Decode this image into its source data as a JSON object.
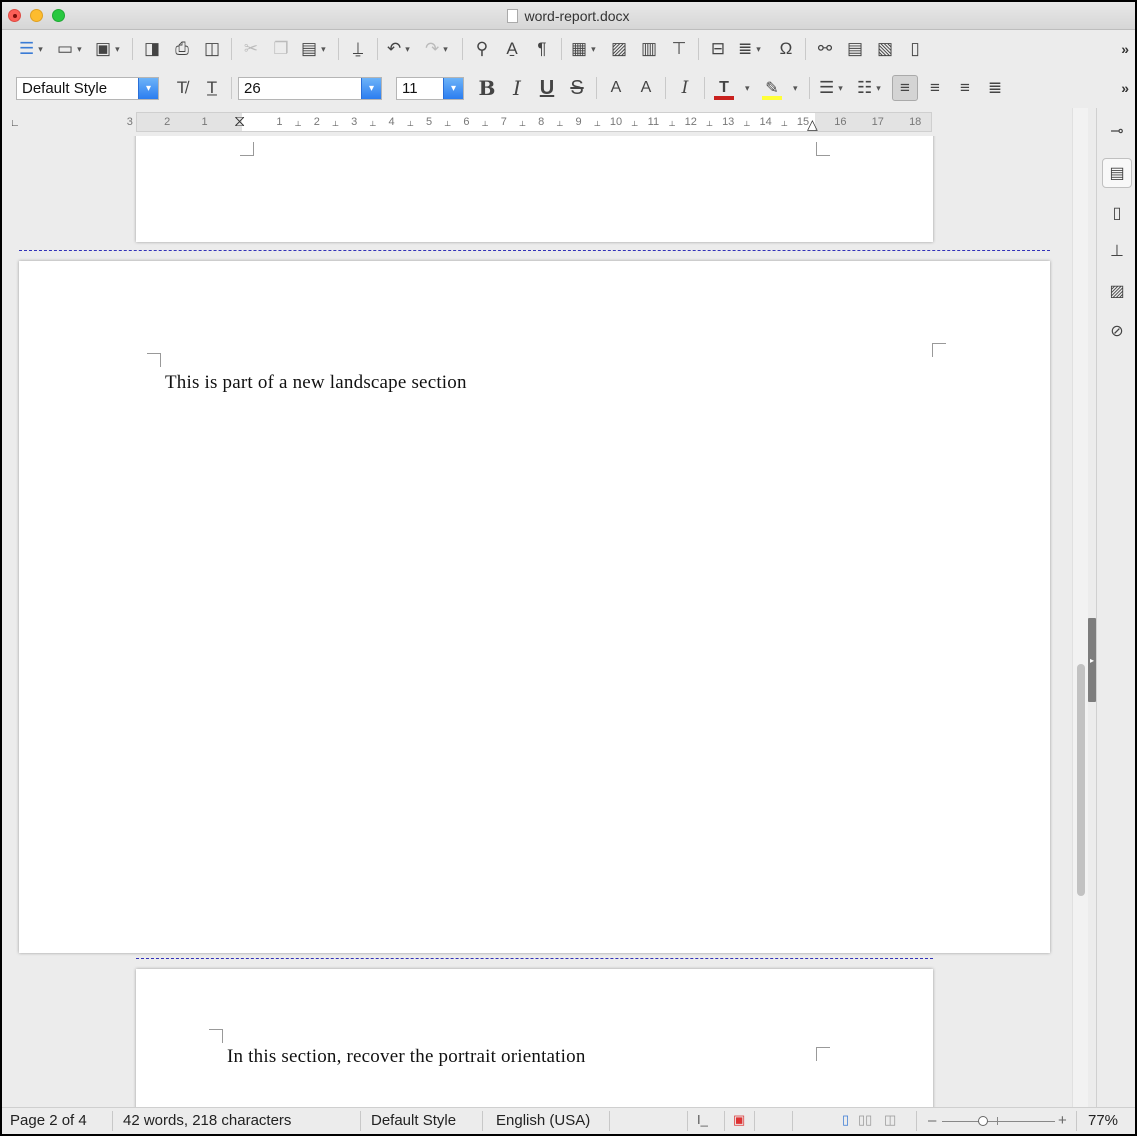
{
  "window": {
    "title": "word-report.docx"
  },
  "toolbar_standard": {
    "icons": [
      "toggle-sidebar-icon",
      "open-folder-icon",
      "save-icon",
      "export-pdf-icon",
      "print-icon",
      "print-preview-icon",
      "cut-icon",
      "copy-icon",
      "paste-icon",
      "clone-formatting-icon",
      "undo-icon",
      "redo-icon",
      "find-replace-icon",
      "spelling-icon",
      "formatting-marks-icon",
      "insert-table-icon",
      "insert-image-icon",
      "insert-chart-icon",
      "insert-textbox-icon",
      "insert-page-break-icon",
      "insert-field-icon",
      "special-character-icon",
      "insert-hyperlink-icon",
      "insert-footnote-icon",
      "insert-endnote-icon",
      "insert-bookmark-icon"
    ]
  },
  "toolbar_formatting": {
    "paragraph_style": "Default Style",
    "font_name": "26",
    "font_size": "11",
    "bold_label": "B",
    "italic_label": "I",
    "underline_label": "U",
    "strike_label": "S",
    "superscript_label": "A",
    "subscript_label": "A",
    "clear_format_label": "I",
    "font_color": "#c9211e",
    "highlight_color": "#ffff38"
  },
  "ruler": {
    "ticks": [
      "3",
      "2",
      "1",
      "1",
      "2",
      "3",
      "4",
      "5",
      "6",
      "7",
      "8",
      "9",
      "10",
      "11",
      "12",
      "13",
      "14",
      "15",
      "16",
      "17",
      "18"
    ]
  },
  "document": {
    "landscape_text": "This is part of a new landscape section",
    "portrait_text": "In this section, recover the portrait orientation"
  },
  "statusbar": {
    "page": "Page 2 of 4",
    "word_count": "42 words, 218 characters",
    "page_style": "Default Style",
    "language": "English (USA)",
    "zoom_minus": "–",
    "zoom_plus": "+",
    "zoom": "77%"
  },
  "sidebar": {
    "buttons": [
      "properties-icon",
      "styles-icon",
      "page-icon",
      "style-inspector-icon",
      "gallery-icon",
      "navigator-icon"
    ]
  },
  "colors": {
    "page_break": "#3232b8",
    "accent": "#2b7df0"
  }
}
